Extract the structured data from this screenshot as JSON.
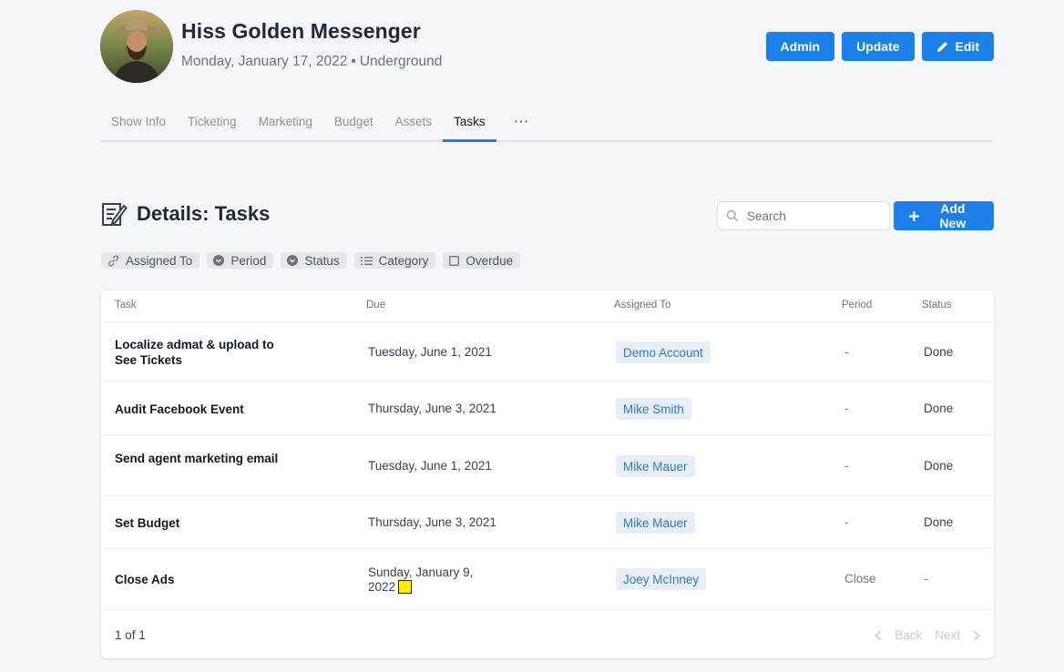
{
  "header": {
    "title": "Hiss Golden Messenger",
    "date": "Monday, January 17, 2022",
    "separator": "•",
    "venue": "Underground",
    "buttons": {
      "admin": "Admin",
      "update": "Update",
      "edit": "Edit"
    }
  },
  "tabs": [
    {
      "label": "Show Info"
    },
    {
      "label": "Ticketing"
    },
    {
      "label": "Marketing"
    },
    {
      "label": "Budget"
    },
    {
      "label": "Assets"
    },
    {
      "label": "Tasks",
      "active": true
    },
    {
      "label": "···"
    }
  ],
  "section": {
    "title": "Details: Tasks",
    "search_placeholder": "Search",
    "add_label": "Add New"
  },
  "filters": {
    "assigned_to": "Assigned To",
    "period": "Period",
    "status": "Status",
    "category": "Category",
    "overdue": "Overdue"
  },
  "table": {
    "headers": {
      "task": "Task",
      "due": "Due",
      "assigned": "Assigned To",
      "period": "Period",
      "status": "Status"
    },
    "rows": [
      {
        "task": "Localize admat & upload to See Tickets",
        "due": "Tuesday, June 1, 2021",
        "assigned": "Demo Account",
        "period": "-",
        "status": "Done"
      },
      {
        "task": "Audit Facebook Event",
        "due": "Thursday, June 3, 2021",
        "assigned": "Mike Smith",
        "period": "-",
        "status": "Done"
      },
      {
        "task": "Send agent marketing email",
        "due": "Tuesday, June 1, 2021",
        "assigned": "Mike Mauer",
        "period": "-",
        "status": "Done"
      },
      {
        "task": "Set Budget",
        "due": "Thursday, June 3, 2021",
        "assigned": "Mike Mauer",
        "period": "-",
        "status": "Done"
      },
      {
        "task": "Close Ads",
        "due": "Sunday, January 9, 2022",
        "assigned": "Joey McInney",
        "period": "Close",
        "status": "-"
      }
    ]
  },
  "pagination": {
    "summary": "1 of 1",
    "back": "Back",
    "next": "Next"
  },
  "colors": {
    "accent": "#1d7fe8",
    "background": "#f4f6fa",
    "chip": "#e5e7eb",
    "highlight": "#ffee00"
  }
}
